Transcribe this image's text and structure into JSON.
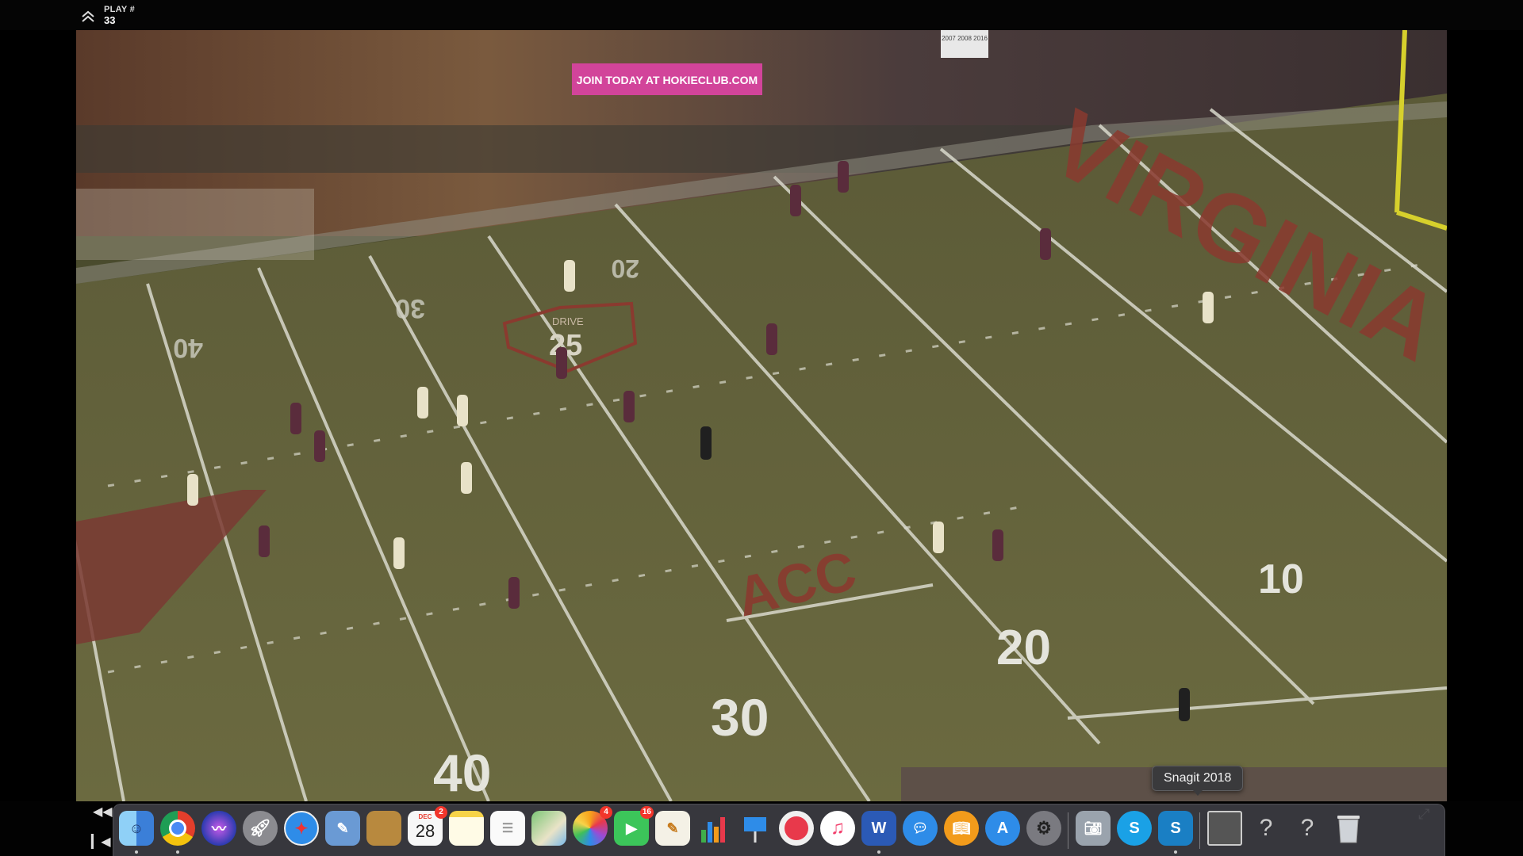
{
  "overlay": {
    "play_label": "PLAY #",
    "play_number": "33",
    "collapse_icon": "chevron-up-double-icon"
  },
  "field": {
    "end_zone_text": "VIRGINIA",
    "midfield_text": "ACC",
    "logo_top": "DRIVE",
    "logo_number": "25",
    "banner_text": "JOIN TODAY AT HOKIECLUB.COM",
    "yard_numbers_near": [
      "10",
      "20",
      "30",
      "40"
    ],
    "yard_numbers_far": [
      "20",
      "30",
      "40"
    ],
    "stadium_sign": "2007 2008 2016"
  },
  "tooltip": {
    "text": "Snagit 2018"
  },
  "controls": {
    "rewind_icon": "rewind-icon",
    "skip_back_icon": "skip-back-icon",
    "fullscreen_icon": "fullscreen-icon"
  },
  "dock": {
    "calendar_month": "DEC",
    "calendar_day": "28",
    "calendar_badge": "2",
    "photos_badge": "4",
    "facetime_badge": "16",
    "snagit_label": "S",
    "skype_label": "S",
    "word_label": "W",
    "icons": [
      "finder-icon",
      "chrome-icon",
      "siri-icon",
      "launchpad-icon",
      "safari-icon",
      "preview-icon",
      "notebook-icon",
      "calendar-icon",
      "notes-icon",
      "reminders-icon",
      "maps-icon",
      "photos-icon",
      "facetime-icon",
      "textedit-icon",
      "numbers-icon",
      "keynote-icon",
      "news-icon",
      "music-icon",
      "word-icon",
      "messages-icon",
      "books-icon",
      "appstore-icon",
      "system-preferences-icon",
      "image-capture-icon",
      "skype-icon",
      "snagit-icon",
      "screenshot-thumb-icon",
      "unknown-app-icon",
      "unknown-app-icon",
      "trash-icon"
    ],
    "unknown_glyph": "?"
  }
}
